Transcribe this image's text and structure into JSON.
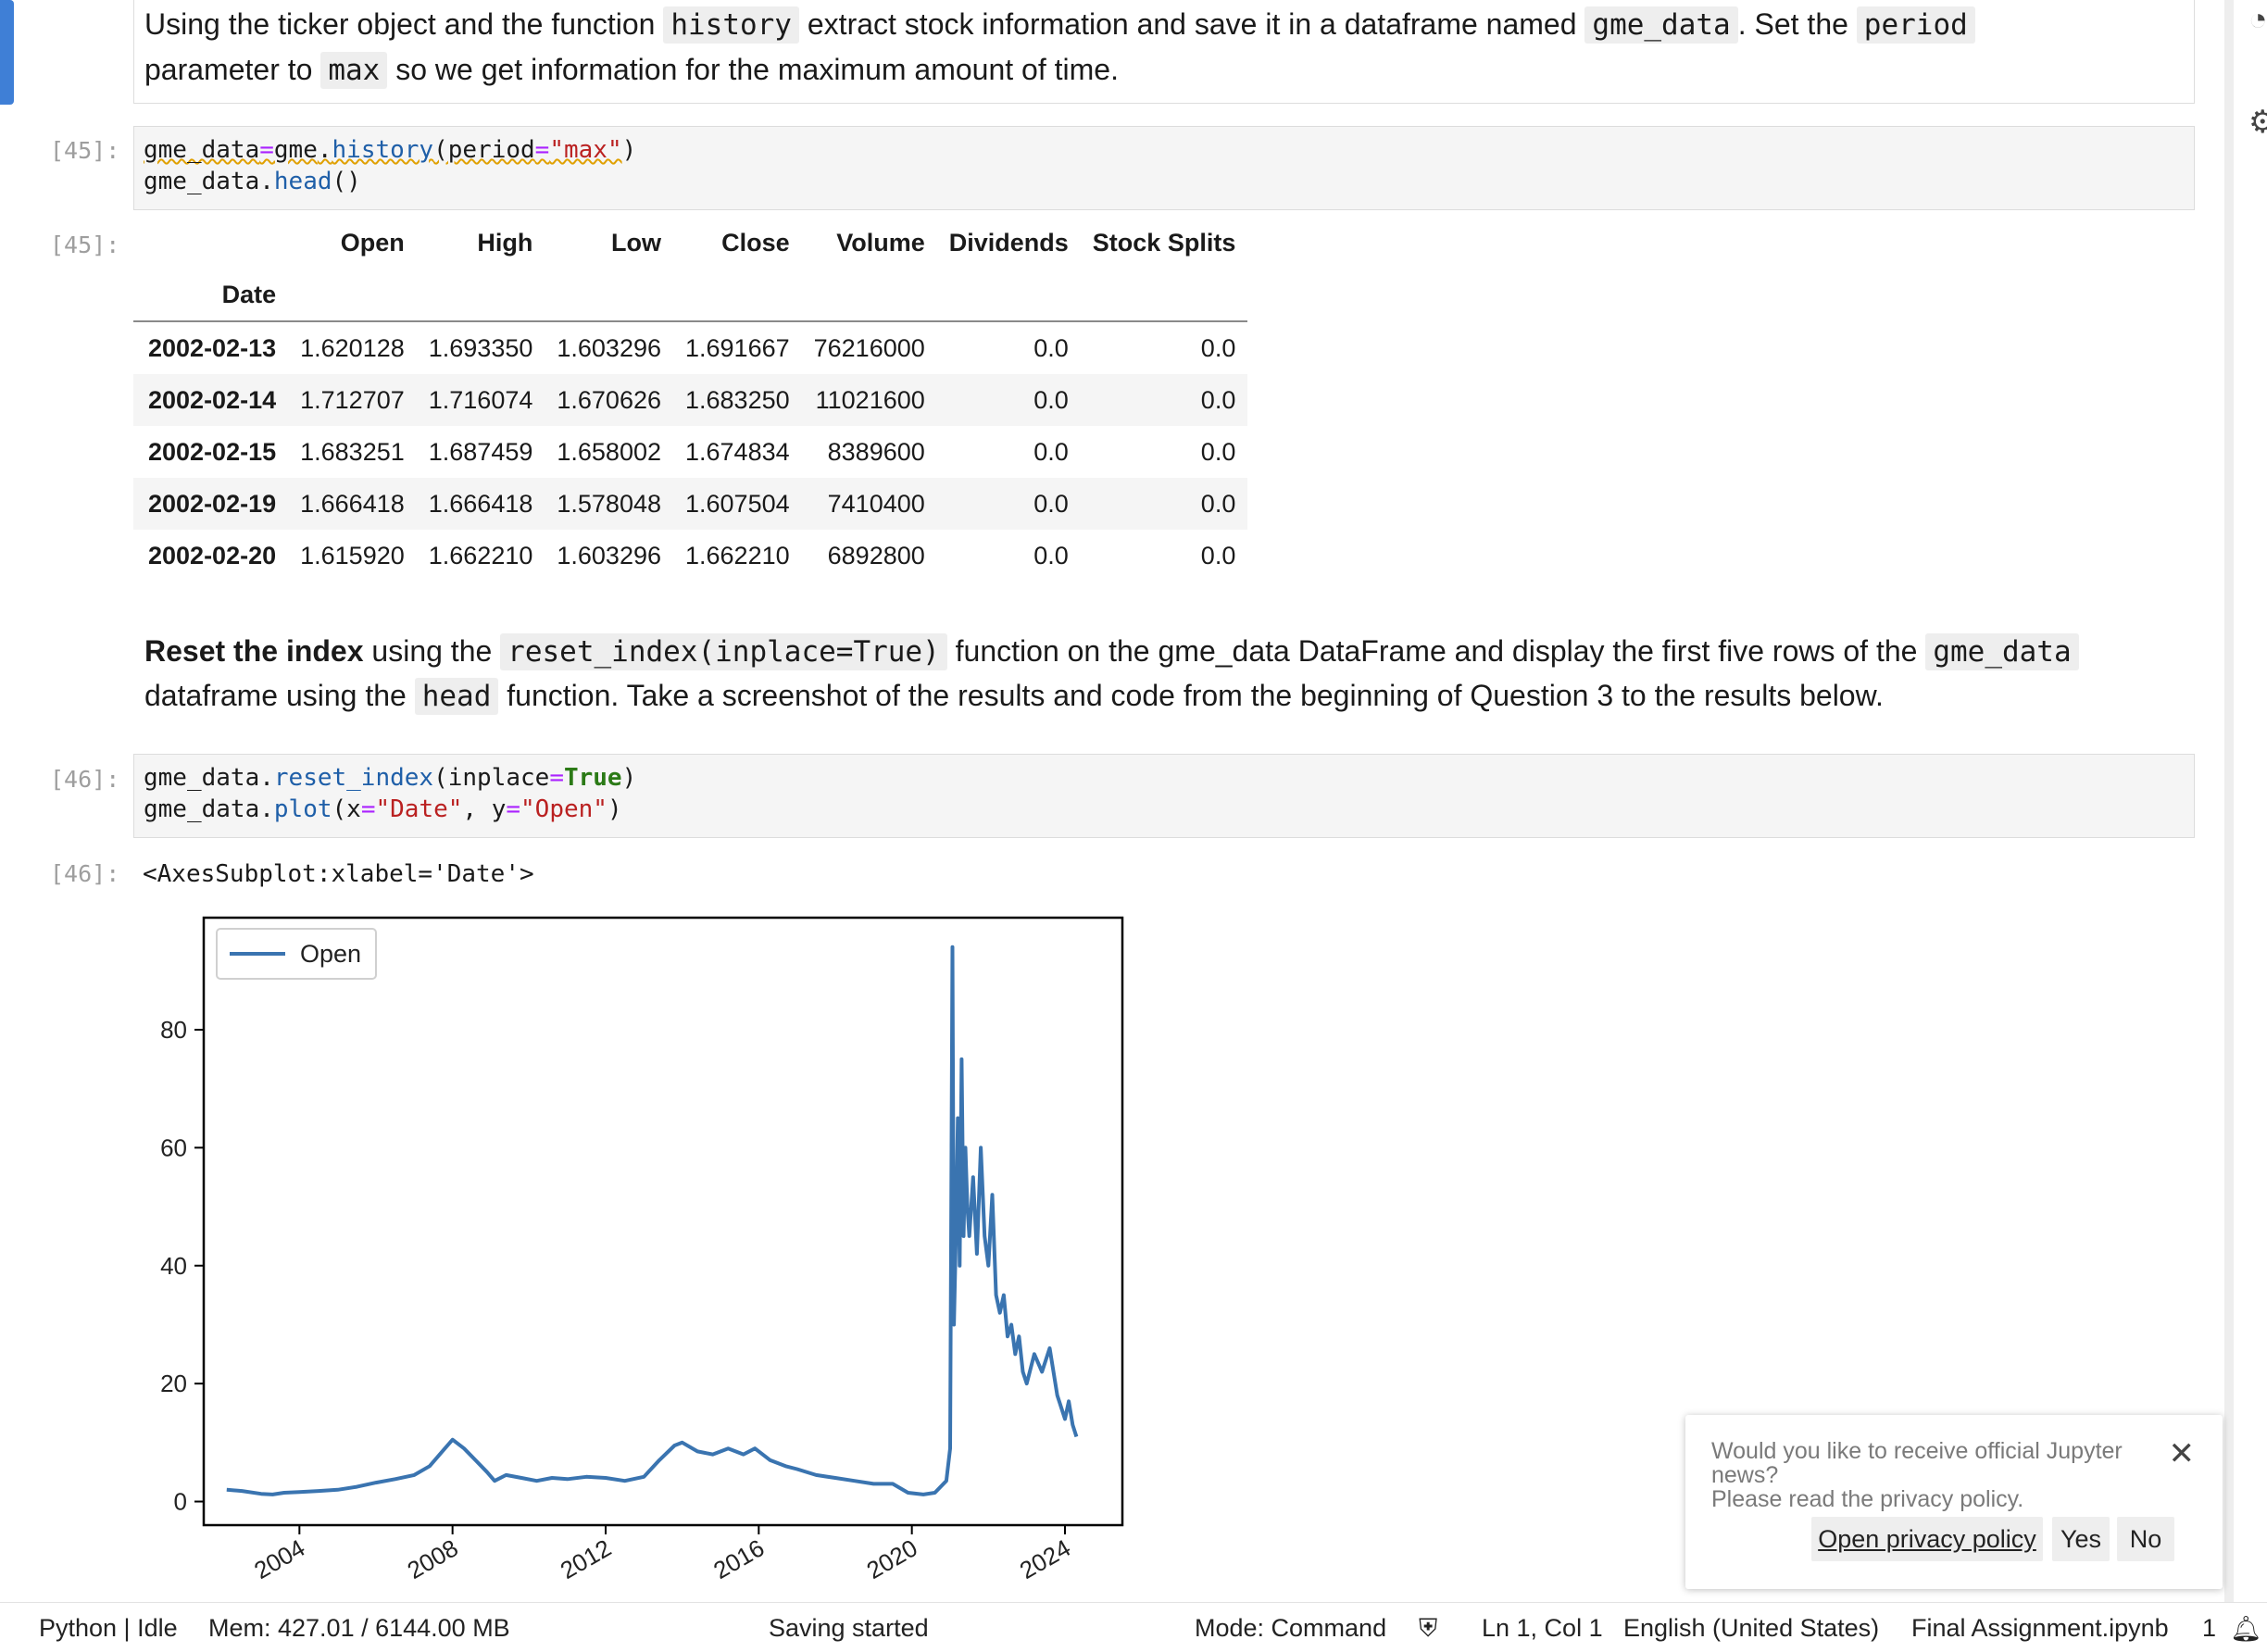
{
  "cells": {
    "md1": {
      "line1_pre": "Using the ticker object and the function ",
      "line1_code1": "history",
      "line1_mid": " extract stock information and save it in a dataframe named ",
      "line1_code2": "gme_data",
      "line1_post": ". Set the ",
      "line1_code3": "period",
      "line2_pre": "parameter to ",
      "line2_code": "max",
      "line2_post": " so we get information for the maximum amount of time."
    },
    "c45": {
      "in_prompt": "[45]:",
      "out_prompt": "[45]:",
      "l1_a": "gme_data",
      "l1_eq": "=",
      "l1_b": "gme",
      "l1_dot": ".",
      "l1_fn": "history",
      "l1_c": "(period",
      "l1_eq2": "=",
      "l1_str": "\"max\"",
      "l1_close": ")",
      "l2_a": "gme_data.",
      "l2_fn": "head",
      "l2_b": "()"
    },
    "df": {
      "columns": [
        "Open",
        "High",
        "Low",
        "Close",
        "Volume",
        "Dividends",
        "Stock Splits"
      ],
      "index_name": "Date",
      "rows": [
        {
          "date": "2002-02-13",
          "vals": [
            "1.620128",
            "1.693350",
            "1.603296",
            "1.691667",
            "76216000",
            "0.0",
            "0.0"
          ]
        },
        {
          "date": "2002-02-14",
          "vals": [
            "1.712707",
            "1.716074",
            "1.670626",
            "1.683250",
            "11021600",
            "0.0",
            "0.0"
          ]
        },
        {
          "date": "2002-02-15",
          "vals": [
            "1.683251",
            "1.687459",
            "1.658002",
            "1.674834",
            "8389600",
            "0.0",
            "0.0"
          ]
        },
        {
          "date": "2002-02-19",
          "vals": [
            "1.666418",
            "1.666418",
            "1.578048",
            "1.607504",
            "7410400",
            "0.0",
            "0.0"
          ]
        },
        {
          "date": "2002-02-20",
          "vals": [
            "1.615920",
            "1.662210",
            "1.603296",
            "1.662210",
            "6892800",
            "0.0",
            "0.0"
          ]
        }
      ]
    },
    "md2": {
      "bold": "Reset the index",
      "pre": " using the ",
      "code1": "reset_index(inplace=True)",
      "mid": " function on the gme_data DataFrame and display the first five rows of the ",
      "code2": "gme_data",
      "line2_pre": "dataframe using the ",
      "line2_code": "head",
      "line2_post": " function. Take a screenshot of the results and code from the beginning of Question 3 to the results below."
    },
    "c46": {
      "in_prompt": "[46]:",
      "out_prompt": "[46]:",
      "l1_a": "gme_data.",
      "l1_fn": "reset_index",
      "l1_b": "(inplace",
      "l1_eq": "=",
      "l1_kw": "True",
      "l1_c": ")",
      "l2_a": "gme_data.",
      "l2_fn": "plot",
      "l2_b": "(x",
      "l2_eq": "=",
      "l2_s1": "\"Date\"",
      "l2_c": ", y",
      "l2_eq2": "=",
      "l2_s2": "\"Open\"",
      "l2_d": ")",
      "output_text": "<AxesSubplot:xlabel='Date'>"
    }
  },
  "chart_data": {
    "type": "line",
    "title": "",
    "xlabel": "",
    "ylabel": "",
    "legend": {
      "position": "top-left",
      "entries": [
        "Open"
      ]
    },
    "color": "#3a74b0",
    "grid": false,
    "xlim": [
      2001.5,
      2025.5
    ],
    "ylim": [
      -4,
      99
    ],
    "x_ticks": [
      2004,
      2008,
      2012,
      2016,
      2020,
      2024
    ],
    "x_tick_labels": [
      "2004",
      "2008",
      "2012",
      "2016",
      "2020",
      "2024"
    ],
    "y_ticks": [
      0,
      20,
      40,
      60,
      80
    ],
    "y_tick_labels": [
      "0",
      "20",
      "40",
      "60",
      "80"
    ],
    "series": [
      {
        "name": "Open",
        "x": [
          2002.1,
          2002.5,
          2003.0,
          2003.3,
          2003.6,
          2004.0,
          2004.5,
          2005.0,
          2005.5,
          2006.0,
          2006.5,
          2007.0,
          2007.4,
          2007.8,
          2008.0,
          2008.3,
          2008.6,
          2008.9,
          2009.1,
          2009.4,
          2009.8,
          2010.2,
          2010.6,
          2011.0,
          2011.5,
          2012.0,
          2012.5,
          2013.0,
          2013.4,
          2013.8,
          2014.0,
          2014.4,
          2014.8,
          2015.2,
          2015.6,
          2015.9,
          2016.3,
          2016.7,
          2017.0,
          2017.5,
          2018.0,
          2018.5,
          2019.0,
          2019.5,
          2019.9,
          2020.3,
          2020.6,
          2020.9,
          2021.0,
          2021.06,
          2021.1,
          2021.15,
          2021.2,
          2021.25,
          2021.3,
          2021.35,
          2021.4,
          2021.45,
          2021.5,
          2021.6,
          2021.7,
          2021.8,
          2021.9,
          2022.0,
          2022.1,
          2022.2,
          2022.3,
          2022.4,
          2022.5,
          2022.6,
          2022.7,
          2022.8,
          2022.9,
          2023.0,
          2023.2,
          2023.4,
          2023.6,
          2023.8,
          2024.0,
          2024.1,
          2024.2,
          2024.3
        ],
        "y": [
          2.0,
          1.8,
          1.3,
          1.2,
          1.5,
          1.6,
          1.8,
          2.0,
          2.5,
          3.2,
          3.8,
          4.5,
          6.0,
          9.0,
          10.5,
          9.0,
          7.0,
          5.0,
          3.5,
          4.5,
          4.0,
          3.5,
          4.0,
          3.8,
          4.2,
          4.0,
          3.5,
          4.2,
          7.0,
          9.5,
          10.0,
          8.5,
          8.0,
          9.0,
          8.0,
          9.0,
          7.0,
          6.0,
          5.5,
          4.5,
          4.0,
          3.5,
          3.0,
          3.0,
          1.5,
          1.2,
          1.5,
          3.5,
          9.0,
          94.0,
          30.0,
          45.0,
          65.0,
          40.0,
          75.0,
          45.0,
          60.0,
          50.0,
          45.0,
          55.0,
          42.0,
          60.0,
          45.0,
          40.0,
          52.0,
          35.0,
          32.0,
          35.0,
          28.0,
          30.0,
          25.0,
          28.0,
          22.0,
          20.0,
          25.0,
          22.0,
          26.0,
          18.0,
          14.0,
          17.0,
          13.0,
          11.0
        ]
      }
    ]
  },
  "toast": {
    "message": "Would you like to receive official Jupyter news?",
    "message2": "Please read the privacy policy.",
    "open_policy": "Open privacy policy",
    "yes": "Yes",
    "no": "No"
  },
  "status_bar": {
    "kernel": "Python | Idle",
    "memory": "Mem: 427.01 / 6144.00 MB",
    "saving": "Saving started",
    "mode": "Mode: Command",
    "position": "Ln 1, Col 1",
    "language": "English (United States)",
    "filename": "Final Assignment.ipynb",
    "notifications": "1"
  }
}
